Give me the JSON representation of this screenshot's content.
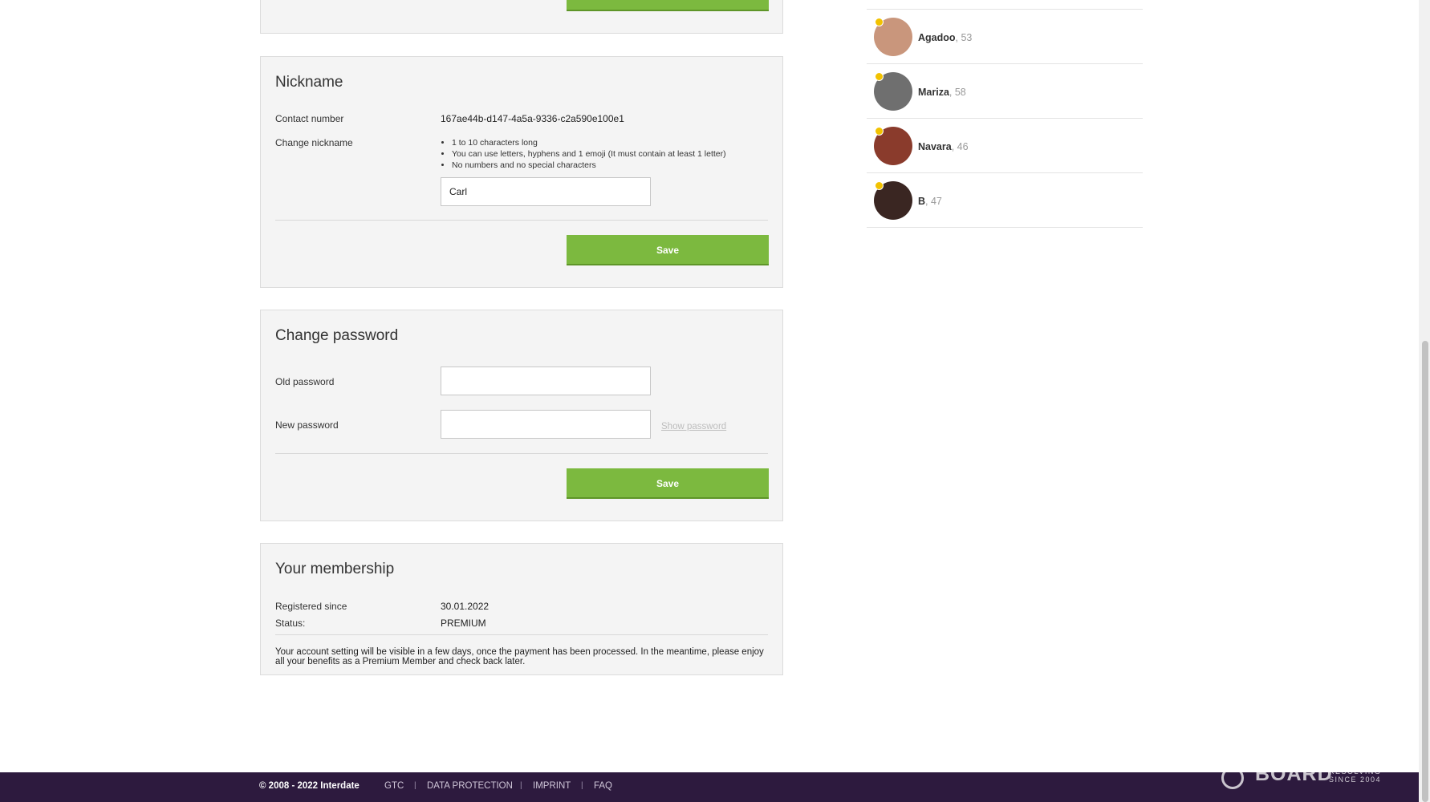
{
  "nickname_section": {
    "title": "Nickname",
    "contact_label": "Contact number",
    "contact_value": "167ae44b-d147-4a5a-9336-c2a590e100e1",
    "change_label": "Change nickname",
    "rules": [
      "1 to 10 characters long",
      "You can use letters, hyphens and 1 emoji (It must contain at least 1 letter)",
      "No numbers and no special characters"
    ],
    "nickname_value": "Carl",
    "save_label": "Save"
  },
  "password_section": {
    "title": "Change password",
    "old_label": "Old password",
    "new_label": "New password",
    "show_password": "Show password",
    "save_label": "Save"
  },
  "membership_section": {
    "title": "Your membership",
    "registered_label": "Registered since",
    "registered_value": "30.01.2022",
    "status_label": "Status:",
    "status_value": "PREMIUM",
    "notice": "Your account setting will be visible in a few days, once the payment has been processed. In the meantime, please enjoy all your benefits as a Premium Member and check back later."
  },
  "contacts": [
    {
      "name": "Agadoo",
      "age": ", 53",
      "avatar_color": "#c9967c"
    },
    {
      "name": "Mariza",
      "age": ", 58",
      "avatar_color": "#6f6f6f"
    },
    {
      "name": "Navara",
      "age": ", 46",
      "avatar_color": "#8a3b2c"
    },
    {
      "name": "B",
      "age": ", 47",
      "avatar_color": "#3a2622"
    }
  ],
  "footer": {
    "copyright": "© 2008 - 2022 Interdate",
    "links": [
      "GTC",
      "DATA PROTECTION",
      "IMPRINT",
      "FAQ"
    ],
    "separator": "|",
    "logo_text": "BOARD",
    "logo_sub": "RESOLVING SINCE 2004"
  },
  "colors": {
    "accent_green": "#7cb93f",
    "footer_bg": "#2d1a3e",
    "online_dot": "#f2c200"
  }
}
